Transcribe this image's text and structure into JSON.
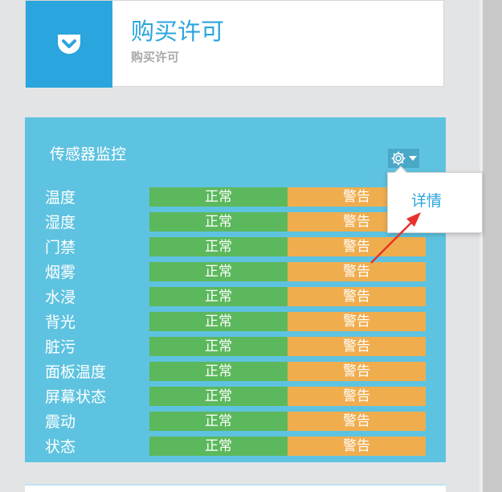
{
  "license": {
    "title": "购买许可",
    "subtitle": "购买许可",
    "icon": "pocket-icon",
    "accent_color": "#2aa5dd"
  },
  "monitor": {
    "title": "传感器监控",
    "settings_icon": "gear-icon",
    "panel_color": "#5ec3e0",
    "normal_label": "正常",
    "warning_label": "警告",
    "normal_color": "#5cb85c",
    "warning_color": "#f0ad4e",
    "rows": [
      {
        "label": "温度"
      },
      {
        "label": "湿度"
      },
      {
        "label": "门禁"
      },
      {
        "label": "烟雾"
      },
      {
        "label": "水浸"
      },
      {
        "label": "背光"
      },
      {
        "label": "脏污"
      },
      {
        "label": "面板温度"
      },
      {
        "label": "屏幕状态"
      },
      {
        "label": "震动"
      },
      {
        "label": "状态"
      }
    ]
  },
  "dropdown": {
    "items": [
      {
        "label": "详情"
      }
    ]
  }
}
